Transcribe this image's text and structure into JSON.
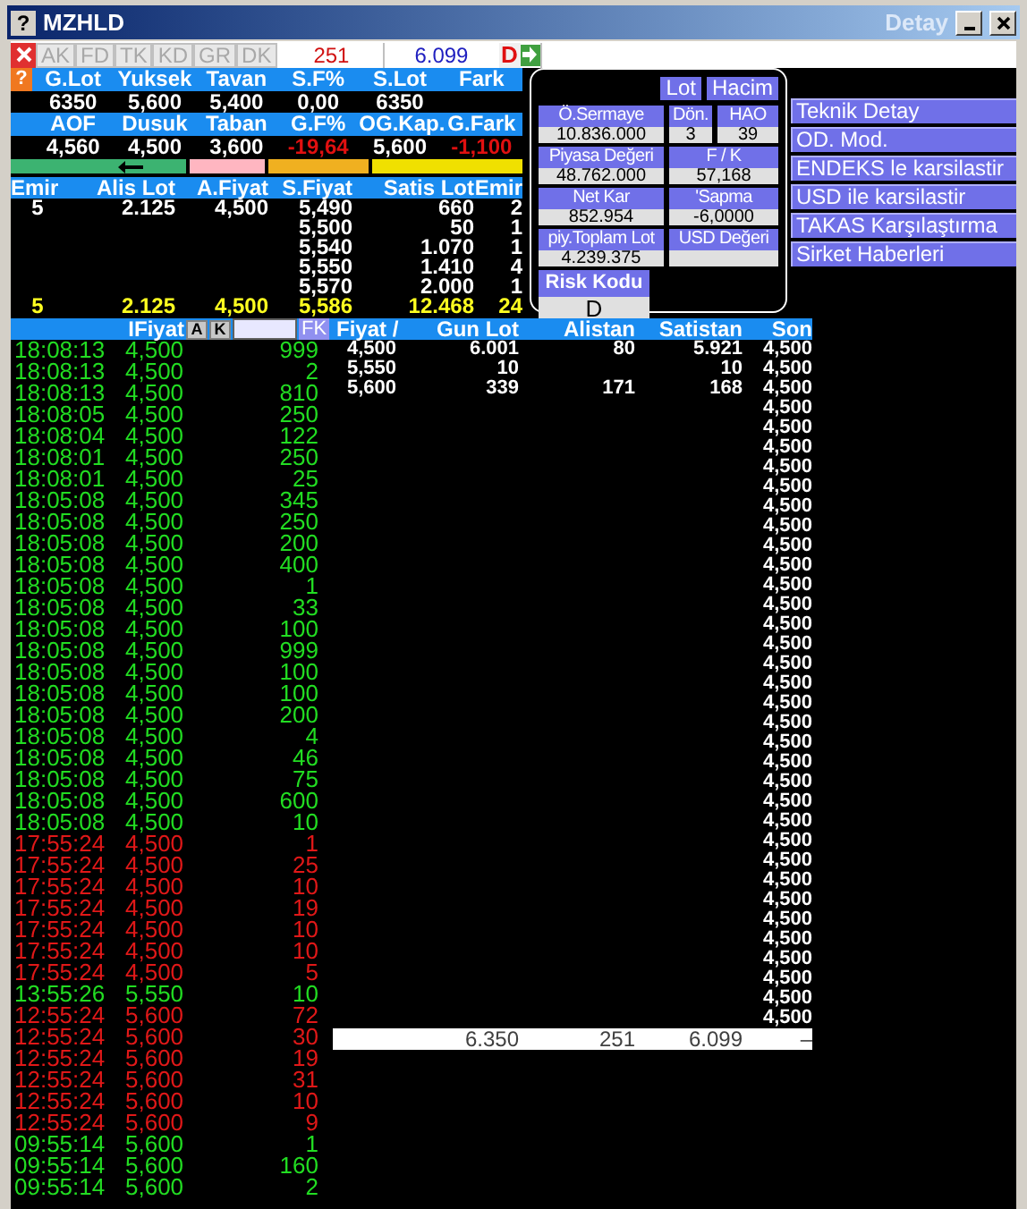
{
  "window": {
    "help": "?",
    "title": "MZHLD",
    "detail_title": "Detay"
  },
  "info_help": "?",
  "toolbar": {
    "tabs": [
      {
        "label": "AK",
        "disabled": true
      },
      {
        "label": "FD",
        "disabled": true
      },
      {
        "label": "TK",
        "disabled": true
      },
      {
        "label": "KD",
        "disabled": true
      },
      {
        "label": "GR",
        "disabled": true
      },
      {
        "label": "DK",
        "disabled": true
      }
    ],
    "lot_field": "251",
    "price_field": "6.099",
    "risk_badge": "D"
  },
  "info_rows": [
    {
      "cells": [
        {
          "label": "G.Lot",
          "value": "6350"
        },
        {
          "label": "Yuksek",
          "value": "5,600"
        },
        {
          "label": "Tavan",
          "value": "5,400"
        },
        {
          "label": "S.F%",
          "value": "0,00"
        },
        {
          "label": "S.Lot",
          "value": "6350"
        },
        {
          "label": "Fark"
        }
      ]
    },
    {
      "cells": [
        {
          "label": "AOF",
          "value": "4,560"
        },
        {
          "label": "Dusuk",
          "value": "4,500"
        },
        {
          "label": "Taban",
          "value": "3,600"
        },
        {
          "label": "G.F%",
          "value": "-19,64",
          "negative": true
        },
        {
          "label": "OG.Kap.",
          "value": "5,600"
        },
        {
          "label": "G.Fark",
          "value": "-1,100",
          "negative": true
        }
      ]
    }
  ],
  "order_book": {
    "columns": [
      "Emir",
      "Alis Lot",
      "A.Fiyat",
      "S.Fiyat",
      "Satis Lot",
      "Emir"
    ],
    "rows": [
      {
        "emir": "5",
        "alis_lot": "2.125",
        "a_fiyat": "4,500",
        "s_fiyat": "5,490",
        "satis_lot": "660",
        "emir_2": "2"
      },
      {
        "s_fiyat": "5,500",
        "satis_lot": "50",
        "emir_2": "1"
      },
      {
        "s_fiyat": "5,540",
        "satis_lot": "1.070",
        "emir_2": "1"
      },
      {
        "s_fiyat": "5,550",
        "satis_lot": "1.410",
        "emir_2": "4"
      },
      {
        "s_fiyat": "5,570",
        "satis_lot": "2.000",
        "emir_2": "1"
      }
    ],
    "total": {
      "emir": "5",
      "alis_lot": "2.125",
      "a_fiyat": "4,500",
      "s_fiyat": "5,586",
      "satis_lot": "12.468",
      "emir_2": "24"
    }
  },
  "detail_panel": {
    "buttons": [
      "Lot",
      "Hacim"
    ],
    "rows": [
      [
        {
          "label": "Ö.Sermaye",
          "value": "10.836.000"
        },
        {
          "label": "Dön.",
          "value": "3"
        },
        {
          "label": "HAO",
          "value": "39"
        }
      ],
      [
        {
          "label": "Piyasa Değeri",
          "value": "48.762.000"
        },
        {
          "label": "F / K",
          "value": "57,168"
        }
      ],
      [
        {
          "label": "Net Kar",
          "value": "852.954"
        },
        {
          "label": "'Sapma",
          "value": "-6,0000"
        }
      ],
      [
        {
          "label": "piy.Toplam Lot",
          "value": "4.239.375"
        },
        {
          "label": "USD Değeri"
        }
      ]
    ],
    "risk": {
      "label": "Risk Kodu",
      "value": "D"
    }
  },
  "menu": [
    "Teknik Detay",
    "OD. Mod.",
    "ENDEKS le karsilastir",
    "USD ile karsilastir",
    "TAKAS Karşılaştırma",
    "Sirket Haberleri"
  ],
  "trades": {
    "header": {
      "label": "IFiyat",
      "buttons": [
        "A",
        "K"
      ],
      "filter_button": "FK"
    },
    "rows": [
      {
        "time": "18:08:13",
        "price": "4,500",
        "lot": "999",
        "kind": "up"
      },
      {
        "time": "18:08:13",
        "price": "4,500",
        "lot": "2",
        "kind": "up"
      },
      {
        "time": "18:08:13",
        "price": "4,500",
        "lot": "810",
        "kind": "up"
      },
      {
        "time": "18:08:05",
        "price": "4,500",
        "lot": "250",
        "kind": "up"
      },
      {
        "time": "18:08:04",
        "price": "4,500",
        "lot": "122",
        "kind": "up"
      },
      {
        "time": "18:08:01",
        "price": "4,500",
        "lot": "250",
        "kind": "up"
      },
      {
        "time": "18:08:01",
        "price": "4,500",
        "lot": "25",
        "kind": "up"
      },
      {
        "time": "18:05:08",
        "price": "4,500",
        "lot": "345",
        "kind": "up"
      },
      {
        "time": "18:05:08",
        "price": "4,500",
        "lot": "250",
        "kind": "up"
      },
      {
        "time": "18:05:08",
        "price": "4,500",
        "lot": "200",
        "kind": "up"
      },
      {
        "time": "18:05:08",
        "price": "4,500",
        "lot": "400",
        "kind": "up"
      },
      {
        "time": "18:05:08",
        "price": "4,500",
        "lot": "1",
        "kind": "up"
      },
      {
        "time": "18:05:08",
        "price": "4,500",
        "lot": "33",
        "kind": "up"
      },
      {
        "time": "18:05:08",
        "price": "4,500",
        "lot": "100",
        "kind": "up"
      },
      {
        "time": "18:05:08",
        "price": "4,500",
        "lot": "999",
        "kind": "up"
      },
      {
        "time": "18:05:08",
        "price": "4,500",
        "lot": "100",
        "kind": "up"
      },
      {
        "time": "18:05:08",
        "price": "4,500",
        "lot": "100",
        "kind": "up"
      },
      {
        "time": "18:05:08",
        "price": "4,500",
        "lot": "200",
        "kind": "up"
      },
      {
        "time": "18:05:08",
        "price": "4,500",
        "lot": "4",
        "kind": "up"
      },
      {
        "time": "18:05:08",
        "price": "4,500",
        "lot": "46",
        "kind": "up"
      },
      {
        "time": "18:05:08",
        "price": "4,500",
        "lot": "75",
        "kind": "up"
      },
      {
        "time": "18:05:08",
        "price": "4,500",
        "lot": "600",
        "kind": "up"
      },
      {
        "time": "18:05:08",
        "price": "4,500",
        "lot": "10",
        "kind": "up"
      },
      {
        "time": "17:55:24",
        "price": "4,500",
        "lot": "1",
        "kind": "down"
      },
      {
        "time": "17:55:24",
        "price": "4,500",
        "lot": "25",
        "kind": "down"
      },
      {
        "time": "17:55:24",
        "price": "4,500",
        "lot": "10",
        "kind": "down"
      },
      {
        "time": "17:55:24",
        "price": "4,500",
        "lot": "19",
        "kind": "down"
      },
      {
        "time": "17:55:24",
        "price": "4,500",
        "lot": "10",
        "kind": "down"
      },
      {
        "time": "17:55:24",
        "price": "4,500",
        "lot": "10",
        "kind": "down"
      },
      {
        "time": "17:55:24",
        "price": "4,500",
        "lot": "5",
        "kind": "down"
      },
      {
        "time": "13:55:26",
        "price": "5,550",
        "lot": "10",
        "kind": "up"
      },
      {
        "time": "12:55:24",
        "price": "5,600",
        "lot": "72",
        "kind": "down"
      },
      {
        "time": "12:55:24",
        "price": "5,600",
        "lot": "30",
        "kind": "down"
      },
      {
        "time": "12:55:24",
        "price": "5,600",
        "lot": "19",
        "kind": "down"
      },
      {
        "time": "12:55:24",
        "price": "5,600",
        "lot": "31",
        "kind": "down"
      },
      {
        "time": "12:55:24",
        "price": "5,600",
        "lot": "10",
        "kind": "down"
      },
      {
        "time": "12:55:24",
        "price": "5,600",
        "lot": "9",
        "kind": "down"
      },
      {
        "time": "09:55:14",
        "price": "5,600",
        "lot": "1",
        "kind": "up"
      },
      {
        "time": "09:55:14",
        "price": "5,600",
        "lot": "160",
        "kind": "up"
      },
      {
        "time": "09:55:14",
        "price": "5,600",
        "lot": "2",
        "kind": "up"
      }
    ]
  },
  "price_table": {
    "columns": [
      "Fiyat /",
      "Gun Lot",
      "Alistan",
      "Satistan",
      "Son"
    ],
    "rows": [
      {
        "fiyat": "4,500",
        "gun_lot": "6.001",
        "alistan": "80",
        "satistan": "5.921",
        "son": "4,500"
      },
      {
        "fiyat": "5,550",
        "gun_lot": "10",
        "satistan": "10",
        "son": "4,500"
      },
      {
        "fiyat": "5,600",
        "gun_lot": "339",
        "alistan": "171",
        "satistan": "168",
        "son": "4,500"
      },
      {
        "son": "4,500"
      },
      {
        "son": "4,500"
      },
      {
        "son": "4,500"
      },
      {
        "son": "4,500"
      },
      {
        "son": "4,500"
      },
      {
        "son": "4,500"
      },
      {
        "son": "4,500"
      },
      {
        "son": "4,500"
      },
      {
        "son": "4,500"
      },
      {
        "son": "4,500"
      },
      {
        "son": "4,500"
      },
      {
        "son": "4,500"
      },
      {
        "son": "4,500"
      },
      {
        "son": "4,500"
      },
      {
        "son": "4,500"
      },
      {
        "son": "4,500"
      },
      {
        "son": "4,500"
      },
      {
        "son": "4,500"
      },
      {
        "son": "4,500"
      },
      {
        "son": "4,500"
      },
      {
        "son": "4,500"
      },
      {
        "son": "4,500"
      },
      {
        "son": "4,500"
      },
      {
        "son": "4,500"
      },
      {
        "son": "4,500"
      },
      {
        "son": "4,500"
      },
      {
        "son": "4,500"
      },
      {
        "son": "4,500"
      },
      {
        "son": "4,500"
      },
      {
        "son": "4,500"
      },
      {
        "son": "4,500"
      },
      {
        "son": "4,500"
      }
    ],
    "totals": {
      "gun_lot": "6.350",
      "alistan": "251",
      "satistan": "6.099",
      "son": "–"
    }
  }
}
